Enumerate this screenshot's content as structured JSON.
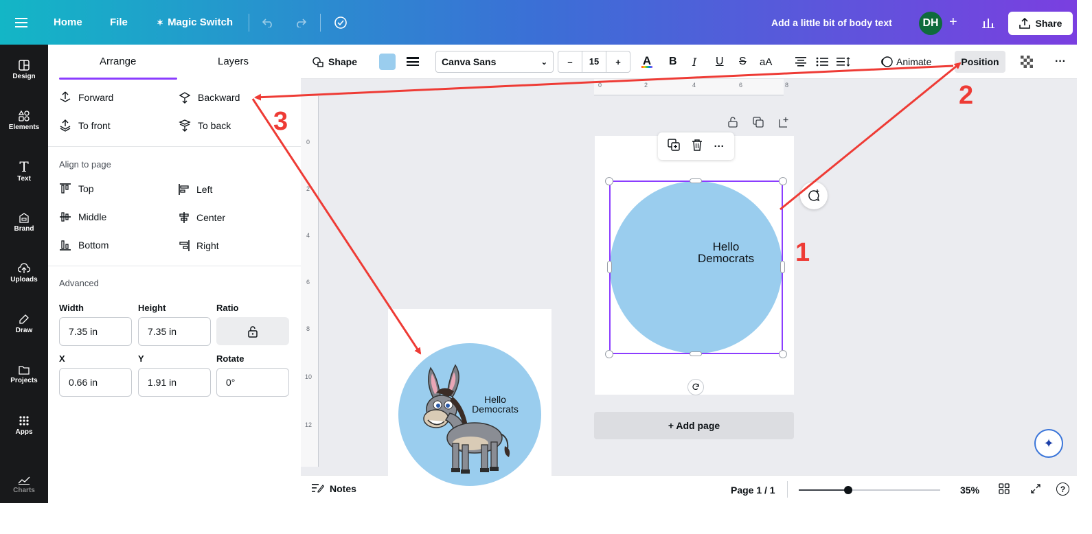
{
  "topbar": {
    "home": "Home",
    "file": "File",
    "magic_switch": "Magic Switch",
    "body_text": "Add a little bit of body text",
    "avatar": "DH",
    "share": "Share"
  },
  "rail": {
    "items": [
      "Design",
      "Elements",
      "Text",
      "Brand",
      "Uploads",
      "Draw",
      "Projects",
      "Apps",
      "Charts"
    ]
  },
  "panel": {
    "tabs": [
      "Arrange",
      "Layers"
    ],
    "order": {
      "forward": "Forward",
      "backward": "Backward",
      "to_front": "To front",
      "to_back": "To back"
    },
    "align_label": "Align to page",
    "align": {
      "top": "Top",
      "left": "Left",
      "middle": "Middle",
      "center": "Center",
      "bottom": "Bottom",
      "right": "Right"
    },
    "advanced_label": "Advanced",
    "fields": {
      "width_label": "Width",
      "width": "7.35 in",
      "height_label": "Height",
      "height": "7.35 in",
      "ratio_label": "Ratio",
      "x_label": "X",
      "x": "0.66 in",
      "y_label": "Y",
      "y": "1.91 in",
      "rotate_label": "Rotate",
      "rotate": "0°"
    }
  },
  "toolbar": {
    "shape": "Shape",
    "fill_color": "#9acdee",
    "font": "Canva Sans",
    "size_minus": "–",
    "size": "15",
    "size_plus": "+",
    "bold": "B",
    "italic": "I",
    "underline": "U",
    "strike": "S",
    "case": "aA",
    "animate": "Animate",
    "position": "Position",
    "more": "···"
  },
  "ruler": {
    "top": [
      "0",
      "2",
      "4",
      "6",
      "8"
    ],
    "left": [
      "0",
      "2",
      "4",
      "6",
      "8",
      "10",
      "12"
    ]
  },
  "canvas": {
    "circle_text_1": "Hello",
    "circle_text_2": "Democrats",
    "add_page": "+ Add page"
  },
  "bottombar": {
    "notes": "Notes",
    "page": "Page 1 / 1",
    "zoom": "35%",
    "zoom_level": 0.35
  },
  "preview": {
    "text_1": "Hello",
    "text_2": "Democrats"
  },
  "annotations": {
    "step1": "1",
    "step2": "2",
    "step3": "3",
    "arrow_color": "#ee3b35"
  },
  "colors": {
    "accent": "#8b3dff",
    "shape_fill": "#9acdee",
    "rail_bg": "#18191b"
  }
}
